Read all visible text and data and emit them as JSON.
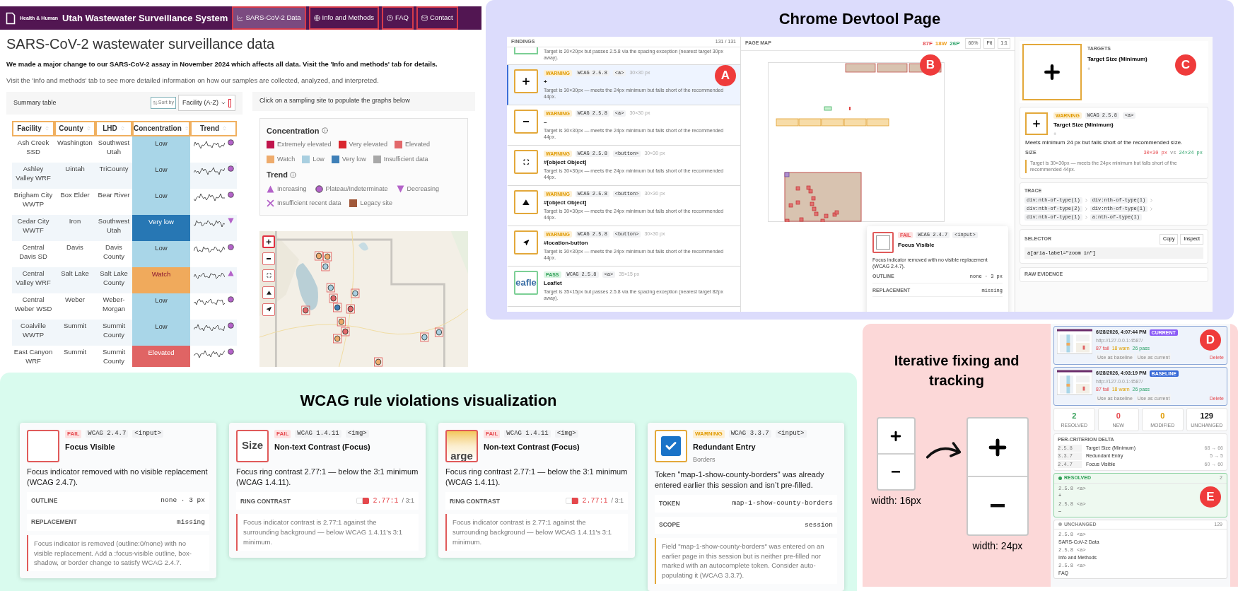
{
  "utah": {
    "header": {
      "logo_text": "Health & Human",
      "title": "Utah Wastewater Surveillance System",
      "nav": [
        {
          "label": "SARS-CoV-2 Data",
          "selected": true
        },
        {
          "label": "Info and Methods",
          "selected": false
        },
        {
          "label": "FAQ",
          "selected": false
        },
        {
          "label": "Contact",
          "selected": false
        }
      ]
    },
    "heading": "SARS-CoV-2 wastewater surveillance data",
    "notice": "We made a major change to our SARS-CoV-2 assay in November 2024 which affects all data. Visit the 'Info and methods' tab for details.",
    "intro": "Visit the 'Info and methods' tab to see more detailed information on how our samples are collected, analyzed, and interpreted.",
    "summary": {
      "title": "Summary table",
      "sort_label": "Sort by",
      "sort_value": "Facility (A-Z)",
      "columns": [
        "Facility",
        "County",
        "LHD",
        "Concentration",
        "Trend"
      ],
      "rows": [
        {
          "facility": "Ash Creek SSD",
          "county": "Washington",
          "lhd": "Southwest Utah",
          "concentration": {
            "label": "Low",
            "kind": "low"
          },
          "trend": {
            "kind": "plateau"
          }
        },
        {
          "facility": "Ashley Valley WRF",
          "county": "Uintah",
          "lhd": "TriCounty",
          "concentration": {
            "label": "Low",
            "kind": "low"
          },
          "trend": {
            "kind": "plateau"
          }
        },
        {
          "facility": "Brigham City WWTP",
          "county": "Box Elder",
          "lhd": "Bear River",
          "concentration": {
            "label": "Low",
            "kind": "low"
          },
          "trend": {
            "kind": "plateau"
          }
        },
        {
          "facility": "Cedar City WWTF",
          "county": "Iron",
          "lhd": "Southwest Utah",
          "concentration": {
            "label": "Very low",
            "kind": "very-low"
          },
          "trend": {
            "kind": "decreasing"
          }
        },
        {
          "facility": "Central Davis SD",
          "county": "Davis",
          "lhd": "Davis County",
          "concentration": {
            "label": "Low",
            "kind": "low"
          },
          "trend": {
            "kind": "plateau"
          }
        },
        {
          "facility": "Central Valley WRF",
          "county": "Salt Lake",
          "lhd": "Salt Lake County",
          "concentration": {
            "label": "Watch",
            "kind": "watch"
          },
          "trend": {
            "kind": "increasing"
          }
        },
        {
          "facility": "Central Weber WSD",
          "county": "Weber",
          "lhd": "Weber-Morgan",
          "concentration": {
            "label": "Low",
            "kind": "low"
          },
          "trend": {
            "kind": "plateau"
          }
        },
        {
          "facility": "Coalville WWTP",
          "county": "Summit",
          "lhd": "Summit County",
          "concentration": {
            "label": "Low",
            "kind": "low"
          },
          "trend": {
            "kind": "plateau"
          }
        },
        {
          "facility": "East Canyon WRF",
          "county": "Summit",
          "lhd": "Summit County",
          "concentration": {
            "label": "Elevated",
            "kind": "elevated"
          },
          "trend": {
            "kind": "plateau"
          }
        }
      ]
    },
    "map_hint": "Click on a sampling site to populate the graphs below",
    "legend": {
      "concentration_title": "Concentration",
      "concentration": [
        {
          "label": "Extremely elevated",
          "color": "#c0144c"
        },
        {
          "label": "Very elevated",
          "color": "#d9262e"
        },
        {
          "label": "Elevated",
          "color": "#e2686a"
        },
        {
          "label": "Watch",
          "color": "#eeab6c"
        },
        {
          "label": "Low",
          "color": "#a9cfe0"
        },
        {
          "label": "Very low",
          "color": "#3f80b8"
        },
        {
          "label": "Insufficient data",
          "color": "#a8a8a8"
        }
      ],
      "trend_title": "Trend",
      "trend": [
        {
          "label": "Increasing",
          "kind": "increasing"
        },
        {
          "label": "Plateau/Indeterminate",
          "kind": "plateau"
        },
        {
          "label": "Decreasing",
          "kind": "decreasing"
        },
        {
          "label": "Insufficient recent data",
          "kind": "insufficient"
        },
        {
          "label": "Legacy site",
          "kind": "legacy"
        }
      ]
    },
    "map": {
      "kind": "picture",
      "controls": [
        {
          "kind": "zoom-in",
          "focused": true
        },
        {
          "kind": "zoom-out",
          "focused": false
        },
        {
          "kind": "fullscreen",
          "focused": false
        },
        {
          "kind": "terrain",
          "focused": false
        },
        {
          "kind": "locate",
          "focused": false
        }
      ]
    }
  },
  "devtool": {
    "title": "Chrome Devtool Page",
    "findings": {
      "title": "FINDINGS",
      "count": "131 / 131",
      "marker": "A",
      "partial_text": "Target is 20×20px but passes 2.5.8 via the spacing exception (nearest target 30px away).",
      "items": [
        {
          "thumbnail": {
            "kind": "plus"
          },
          "kind": "warning",
          "badge": "WARNING",
          "wcag": "WCAG 2.5.8",
          "tag": "<a>",
          "size": "30×30 px",
          "name": "+",
          "text": "Target is 30×30px — meets the 24px minimum but falls short of the recommended 44px.",
          "selected": true
        },
        {
          "thumbnail": {
            "kind": "minus"
          },
          "kind": "warning",
          "badge": "WARNING",
          "wcag": "WCAG 2.5.8",
          "tag": "<a>",
          "size": "30×30 px",
          "name": "–",
          "text": "Target is 30×30px — meets the 24px minimum but falls short of the recommended 44px.",
          "selected": false
        },
        {
          "thumbnail": {
            "kind": "fullscreen"
          },
          "kind": "warning",
          "badge": "WARNING",
          "wcag": "WCAG 2.5.8",
          "tag": "<button>",
          "size": "30×30 px",
          "name": "#[object Object]",
          "text": "Target is 30×30px — meets the 24px minimum but falls short of the recommended 44px.",
          "selected": false
        },
        {
          "thumbnail": {
            "kind": "triangle"
          },
          "kind": "warning",
          "badge": "WARNING",
          "wcag": "WCAG 2.5.8",
          "tag": "<button>",
          "size": "30×30 px",
          "name": "#[object Object]",
          "text": "Target is 30×30px — meets the 24px minimum but falls short of the recommended 44px.",
          "selected": false
        },
        {
          "thumbnail": {
            "kind": "locate"
          },
          "kind": "warning",
          "badge": "WARNING",
          "wcag": "WCAG 2.5.8",
          "tag": "<button>",
          "size": "30×30 px",
          "name": "#location-button",
          "text": "Target is 30×30px — meets the 24px minimum but falls short of the recommended 44px.",
          "selected": false
        },
        {
          "thumbnail": {
            "kind": "text",
            "text": "eafle"
          },
          "kind": "pass",
          "badge": "PASS",
          "wcag": "WCAG 2.5.8",
          "tag": "<a>",
          "size": "35×15 px",
          "name": "Leaflet",
          "text": "Target is 35×15px but passes 2.5.8 via the spacing exception (nearest target 82px away).",
          "selected": false
        }
      ]
    },
    "page_map": {
      "title": "PAGE MAP",
      "marker": "B",
      "counts": [
        {
          "label": "87F",
          "color": "#e5484d"
        },
        {
          "label": "18W",
          "color": "#f0a020"
        },
        {
          "label": "26P",
          "color": "#30a46c"
        }
      ],
      "zoom": "66%",
      "buttons": [
        "Fit",
        "1:1"
      ],
      "popup": {
        "kind": "fail",
        "badge": "FAIL",
        "wcag": "WCAG 2.4.7",
        "tag": "<input>",
        "name": "Focus Visible",
        "text": "Focus indicator removed with no visible replacement (WCAG 2.4.7).",
        "rows": [
          {
            "label": "OUTLINE",
            "value": "none · 3 px"
          },
          {
            "label": "REPLACEMENT",
            "value": "missing"
          }
        ]
      }
    },
    "detail": {
      "marker": "C",
      "targets_label": "TARGETS",
      "target_name": "Target Size (Minimum)",
      "target_sub": "+",
      "card": {
        "kind": "warning",
        "badge": "WARNING",
        "wcag": "WCAG 2.5.8",
        "tag": "<a>",
        "name": "Target Size (Minimum)",
        "sub": "+",
        "text": "Meets minimum 24 px but falls short of the recommended size.",
        "size_label": "SIZE",
        "size_actual": "30×30 px",
        "size_vs": "vs",
        "size_required": "24×24 px",
        "note": "Target is 30×30px — meets the 24px minimum but falls short of the recommended 44px."
      },
      "trace_title": "TRACE",
      "trace": [
        "div:nth-of-type(1)",
        "div:nth-of-type(1)",
        "div:nth-of-type(2)",
        "div:nth-of-type(1)",
        "div:nth-of-type(1)",
        "a:nth-of-type(1)"
      ],
      "selector_title": "SELECTOR",
      "selector_buttons": [
        "Copy",
        "Inspect"
      ],
      "selector": "a[aria-label=\"zoom in\"]",
      "raw_title": "RAW EVIDENCE"
    }
  },
  "wcag": {
    "title": "WCAG rule violations visualization",
    "cards": [
      {
        "kind": "fail",
        "thumbnail": {
          "kind": "empty"
        },
        "badge": "FAIL",
        "wcag": "WCAG 2.4.7",
        "tag": "<input>",
        "name": "Focus Visible",
        "text": "Focus indicator removed with no visible replacement (WCAG 2.4.7).",
        "rows": [
          {
            "kind": "value",
            "label": "OUTLINE",
            "value": "none · 3 px"
          },
          {
            "kind": "value",
            "label": "REPLACEMENT",
            "value": "missing"
          }
        ],
        "note": "Focus indicator is removed (outline:0/none) with no visible replacement. Add a :focus-visible outline, box-shadow, or border change to satisfy WCAG 2.4.7."
      },
      {
        "kind": "fail",
        "thumbnail": {
          "kind": "text",
          "text": "Size"
        },
        "badge": "FAIL",
        "wcag": "WCAG 1.4.11",
        "tag": "<img>",
        "name": "Non-text Contrast (Focus)",
        "text": "Focus ring contrast 2.77:1 — below the 3:1 minimum (WCAG 1.4.11).",
        "rows": [
          {
            "kind": "contrast",
            "label": "RING CONTRAST",
            "value": "2.77:1",
            "threshold": "/ 3:1"
          }
        ],
        "note": "Focus indicator contrast is 2.77:1 against the surrounding background — below WCAG 1.4.11's 3:1 minimum."
      },
      {
        "kind": "fail",
        "thumbnail": {
          "kind": "banner-text",
          "text": "arge"
        },
        "badge": "FAIL",
        "wcag": "WCAG 1.4.11",
        "tag": "<img>",
        "name": "Non-text Contrast (Focus)",
        "text": "Focus ring contrast 2.77:1 — below the 3:1 minimum (WCAG 1.4.11).",
        "rows": [
          {
            "kind": "contrast",
            "label": "RING CONTRAST",
            "value": "2.77:1",
            "threshold": "/ 3:1"
          }
        ],
        "note": "Focus indicator contrast is 2.77:1 against the surrounding background — below WCAG 1.4.11's 3:1 minimum."
      },
      {
        "kind": "warning",
        "thumbnail": {
          "kind": "checkbox"
        },
        "badge": "WARNING",
        "wcag": "WCAG 3.3.7",
        "tag": "<input>",
        "name": "Redundant Entry",
        "sub": "Borders",
        "text": "Token \"map-1-show-county-borders\" was already entered earlier this session and isn’t pre-filled.",
        "rows": [
          {
            "kind": "value",
            "label": "TOKEN",
            "value": "map-1-show-county-borders"
          },
          {
            "kind": "value",
            "label": "SCOPE",
            "value": "session"
          }
        ],
        "note": "Field \"map-1-show-county-borders\" was entered on an earlier page in this session but is neither pre-filled nor marked with an autocomplete token. Consider auto-populating it (WCAG 3.3.7)."
      }
    ]
  },
  "tracking": {
    "title": "Iterative fixing and tracking",
    "before_label": "width: 16px",
    "after_label": "width: 24px",
    "snapshots": [
      {
        "time": "6/28/2026, 4:07:44 PM",
        "badge": "CURRENT",
        "kind": "current",
        "url": "http://127.0.0.1:4587/",
        "fail": "87 fail",
        "warn": "18 warn",
        "pass": "26 pass",
        "actions": [
          "Use as baseline",
          "Use as current"
        ],
        "delete": "Delete",
        "marker": "D"
      },
      {
        "time": "6/28/2026, 4:03:19 PM",
        "badge": "BASELINE",
        "kind": "baseline",
        "url": "http://127.0.0.1:4587/",
        "fail": "87 fail",
        "warn": "18 warn",
        "pass": "26 pass",
        "actions": [
          "Use as baseline",
          "Use as current"
        ],
        "delete": "Delete"
      }
    ],
    "stats": [
      {
        "value": "2",
        "label": "RESOLVED",
        "kind": "resolved"
      },
      {
        "value": "0",
        "label": "NEW",
        "kind": "new"
      },
      {
        "value": "0",
        "label": "MODIFIED",
        "kind": "modified"
      },
      {
        "value": "129",
        "label": "UNCHANGED",
        "kind": "unchanged"
      }
    ],
    "delta_title": "PER-CRITERION DELTA",
    "delta": [
      {
        "code": "2.5.8",
        "name": "Target Size (Minimum)",
        "change": "68 → 66"
      },
      {
        "code": "3.3.7",
        "name": "Redundant Entry",
        "change": "5 → 5"
      },
      {
        "code": "2.4.7",
        "name": "Focus Visible",
        "change": "60 → 60"
      }
    ],
    "groups": [
      {
        "kind": "resolved",
        "title": "RESOLVED",
        "count": "2",
        "marker": "E",
        "items": [
          {
            "code": "2.5.8",
            "tag": "<a>",
            "name": "+"
          },
          {
            "code": "2.5.8",
            "tag": "<a>",
            "name": "–"
          }
        ]
      },
      {
        "kind": "unchanged",
        "title": "UNCHANGED",
        "count": "129",
        "items": [
          {
            "code": "2.5.8",
            "tag": "<a>",
            "name": "SARS-CoV-2 Data"
          },
          {
            "code": "2.5.8",
            "tag": "<a>",
            "name": "Info and Methods"
          },
          {
            "code": "2.5.8",
            "tag": "<a>",
            "name": "FAQ"
          }
        ]
      }
    ]
  }
}
